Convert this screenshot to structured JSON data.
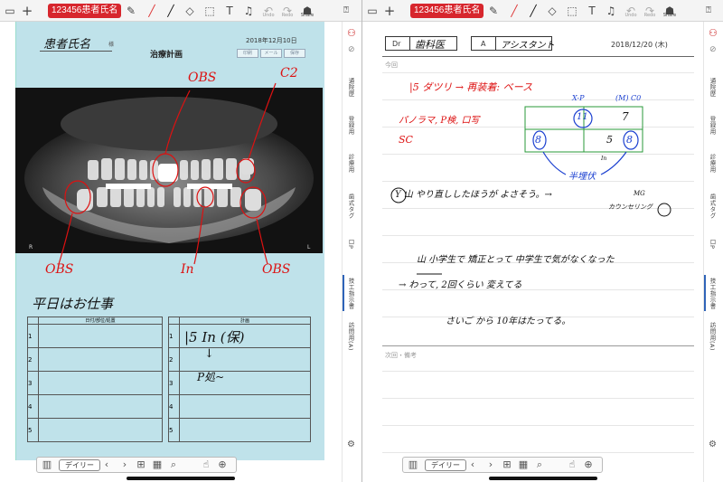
{
  "toolbar": {
    "patient_badge": "123456患者氏名",
    "undo": "Undo",
    "redo": "Redo",
    "share": "Share",
    "text_tool": "T"
  },
  "sidebar": {
    "items": [
      "通院歴",
      "登録用",
      "診療用",
      "歯式タグ",
      "口P",
      "技工指示書",
      "訪問用(A)"
    ]
  },
  "left": {
    "form_name_label": "患者氏名",
    "form_sama": "様",
    "form_title": "治療計画",
    "form_date": "2018年12月10日",
    "form_buttons": [
      "印刷",
      "メール",
      "保存"
    ],
    "xray_left_mark": "R",
    "xray_right_mark": "L",
    "annotations": [
      "OBS",
      "C2",
      "OBS",
      "In",
      "OBS"
    ],
    "note_title": "平日はお仕事",
    "table_left_header": "日付/部位/処置",
    "table_right_header": "計画",
    "row_numbers": [
      "1",
      "2",
      "3",
      "4",
      "5"
    ],
    "plan_line1": "|5 In (保)",
    "plan_line2": "↓",
    "plan_line3": "P処~"
  },
  "right": {
    "dr_label": "Dr",
    "dr_name": "歯科医",
    "a_label": "A",
    "a_name": "アシスタント",
    "date": "2018/12/20 (木)",
    "section_this": "今回",
    "section_next": "次回・備考",
    "hw_line1": "|5 ダツリ → 再装着: ベース",
    "hw_line2": "パノラマ, P検, 口写",
    "hw_line3": "SC",
    "tbl_header_xp": "X-P",
    "tbl_header_m": "(M) C0",
    "tbl_cell_tl": "11",
    "tbl_cell_tr": "7",
    "tbl_cell_bl": "8",
    "tbl_cell_bm": "5",
    "tbl_cell_br": "8",
    "tbl_note": "半埋伏",
    "tbl_small": "In",
    "hw_line4": "Y 山 やり直ししたほうが よさそう。→",
    "hw_mg": "MG",
    "hw_counsel": "カウンセリング",
    "hw_line5": "山 小学生で 矯正とって 中学生で気がなくなった",
    "hw_line6": "→ わって, 2回くらい 変えてる",
    "hw_line7": "さいご から 10年はたってる。"
  },
  "bottombar": {
    "daily_label": "デイリー"
  }
}
